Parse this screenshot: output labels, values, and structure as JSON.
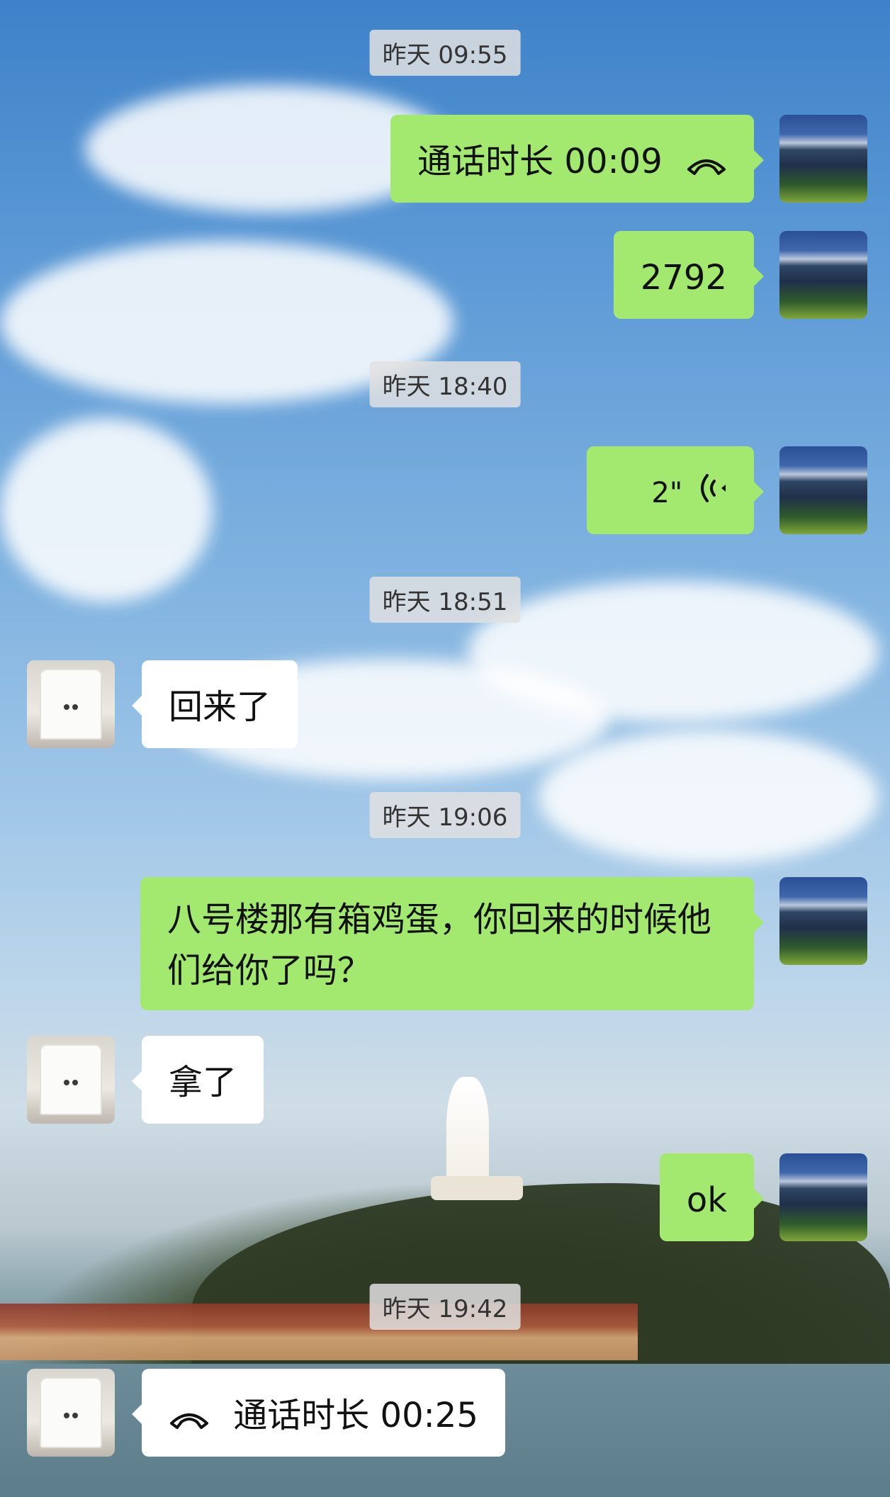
{
  "timestamps": [
    "昨天 09:55",
    "昨天 18:40",
    "昨天 18:51",
    "昨天 19:06",
    "昨天 19:42"
  ],
  "messages": [
    {
      "sender": "me",
      "type": "call",
      "text": "通话时长 00:09",
      "icon": "phone-hangup-icon"
    },
    {
      "sender": "me",
      "type": "text",
      "text": "2792"
    },
    {
      "sender": "me",
      "type": "voice",
      "text": "2\"",
      "icon": "voice-wave-icon"
    },
    {
      "sender": "other",
      "type": "text",
      "text": "回来了"
    },
    {
      "sender": "me",
      "type": "text",
      "text": "八号楼那有箱鸡蛋，你回来的时候他们给你了吗？"
    },
    {
      "sender": "other",
      "type": "text",
      "text": "拿了"
    },
    {
      "sender": "me",
      "type": "text",
      "text": "ok"
    },
    {
      "sender": "other",
      "type": "call",
      "text": "通话时长 00:25",
      "icon": "phone-hangup-icon"
    }
  ],
  "colors": {
    "me_bubble": "#a3e86f",
    "other_bubble": "#ffffff"
  }
}
